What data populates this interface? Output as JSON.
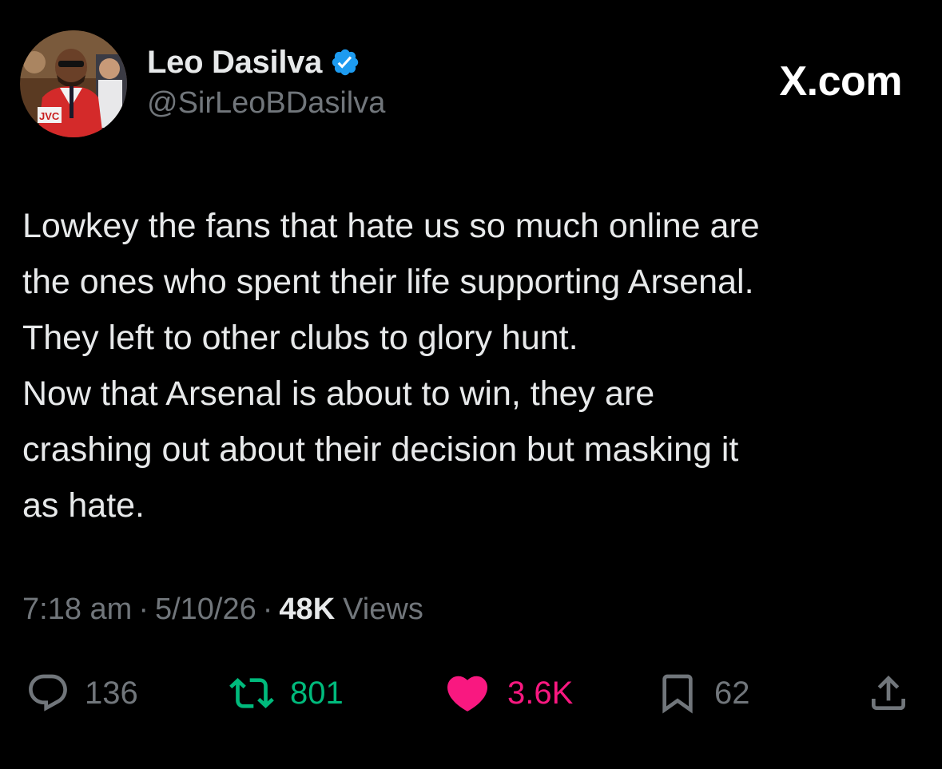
{
  "header": {
    "display_name": "Leo Dasilva",
    "handle": "@SirLeoBDasilva",
    "verified": true,
    "brand": "X.com"
  },
  "avatar": {
    "jersey_text": "JVC"
  },
  "tweet": {
    "lines": [
      "Lowkey the fans that hate us so much online are",
      "the ones who spent their life supporting Arsenal.",
      "They left to other clubs to glory hunt.",
      "Now that Arsenal is about to win, they are",
      "crashing out about their decision but masking it",
      "as hate."
    ]
  },
  "meta": {
    "time": "7:18 am",
    "separator": "·",
    "date": "5/10/26",
    "views_count": "48K",
    "views_label": "Views"
  },
  "actions": {
    "replies": "136",
    "reposts": "801",
    "likes": "3.6K",
    "bookmarks": "62"
  },
  "colors": {
    "background": "#000000",
    "text_primary": "#e7e9ea",
    "text_secondary": "#71767b",
    "verified_blue": "#1d9bf0",
    "repost_green": "#00ba7c",
    "like_pink": "#f91880"
  }
}
